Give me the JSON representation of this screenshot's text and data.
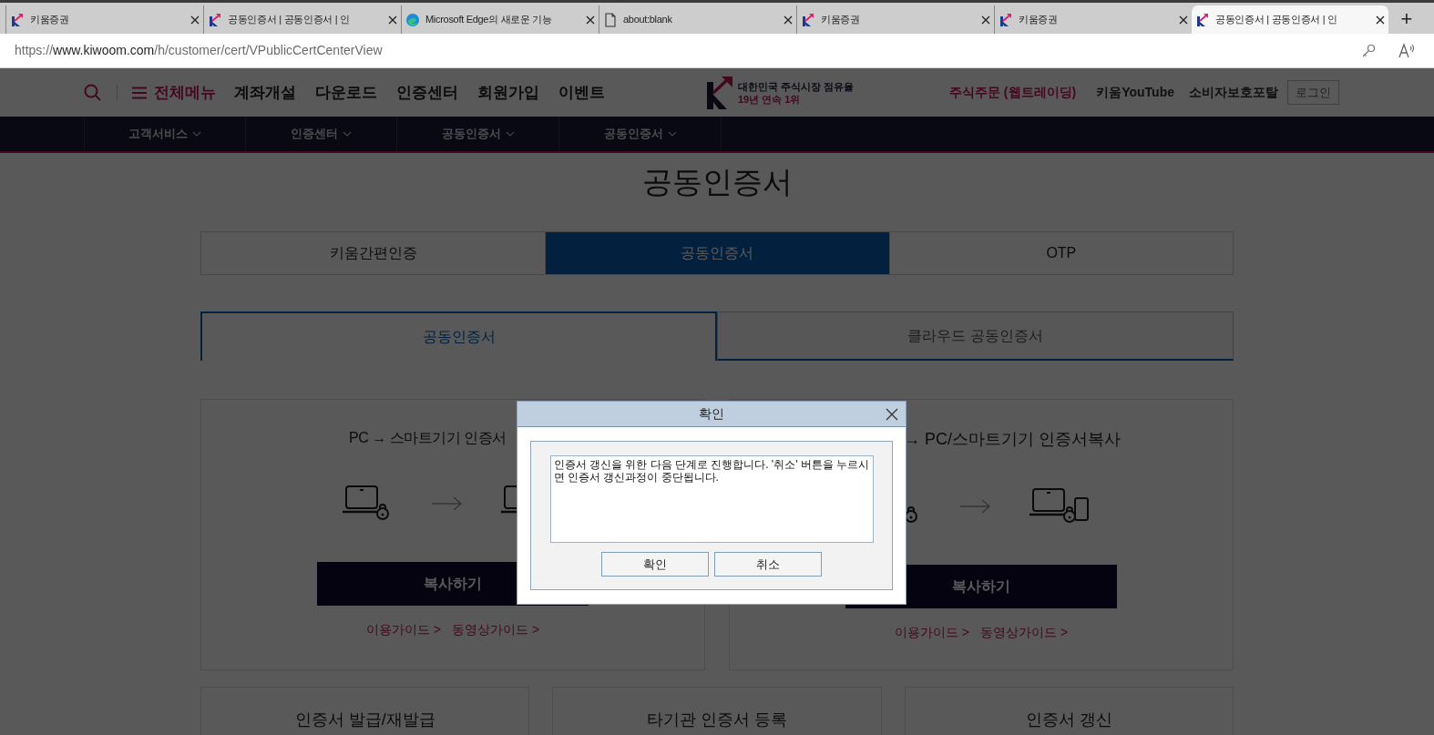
{
  "browser": {
    "tabs": [
      {
        "title": "키움증권",
        "kind": "site",
        "selected": false
      },
      {
        "title": "공동인증서 | 공동인증서 | 인",
        "kind": "site",
        "selected": false
      },
      {
        "title": "Microsoft Edge의 새로운 기능",
        "kind": "browser",
        "selected": false
      },
      {
        "title": "about:blank",
        "kind": "blank",
        "selected": false
      },
      {
        "title": "키움증권",
        "kind": "site",
        "selected": false
      },
      {
        "title": "키움증권",
        "kind": "site",
        "selected": false
      },
      {
        "title": "공동인증서 | 공동인증서 | 인",
        "kind": "site",
        "selected": true
      }
    ],
    "new_tab": "+",
    "url_scheme": "https://",
    "url_host": "www.kiwoom.com",
    "url_path": "/h/customer/cert/VPublicCertCenterView"
  },
  "header": {
    "menu_label": "전체메뉴",
    "nav_links": [
      "계좌개설",
      "다운로드",
      "인증센터",
      "회원가입",
      "이벤트"
    ],
    "logo_line1": "대한민국 주식시장 점유율",
    "logo_line2": "19년 연속 1위",
    "right_links": [
      {
        "label": "주식주문 (웹트레이딩)",
        "kind": "accent"
      },
      {
        "label": "키움**YouTube**",
        "kind": "plain"
      },
      {
        "label": "소비자보호포탈",
        "kind": "plain"
      }
    ],
    "login": "로그인"
  },
  "subnav": [
    "고객서비스",
    "인증센터",
    "공동인증서",
    "공동인증서"
  ],
  "page_title": "공동인증서",
  "auth_tabs": [
    {
      "label": "키움간편인증",
      "selected": false
    },
    {
      "label": "공동인증서",
      "selected": true
    },
    {
      "label": "OTP",
      "selected": false
    }
  ],
  "cert_tabs": [
    {
      "label": "공동인증서",
      "selected": true
    },
    {
      "label": "클라우드 공동인증서",
      "selected": false
    }
  ],
  "cards": [
    {
      "title": "PC → 스마트기기 인증서",
      "button": "복사하기",
      "links": [
        "이용가이드 >",
        "동영상가이드 >"
      ]
    },
    {
      "title": "→ PC/스마트기기 인증서복사",
      "button": "복사하기",
      "links": [
        "이용가이드 >",
        "동영상가이드 >"
      ]
    }
  ],
  "bottom_cards": [
    "인증서 발급/재발급",
    "타기관 인증서 등록",
    "인증서 갱신"
  ],
  "dialog": {
    "title": "확인",
    "message": "인증서 갱신을 위한 다음 단계로 진행합니다. '취소' 버튼을 누르시면 인증서 갱신과정이 중단됩니다.",
    "buttons": [
      "확인",
      "취소"
    ]
  }
}
